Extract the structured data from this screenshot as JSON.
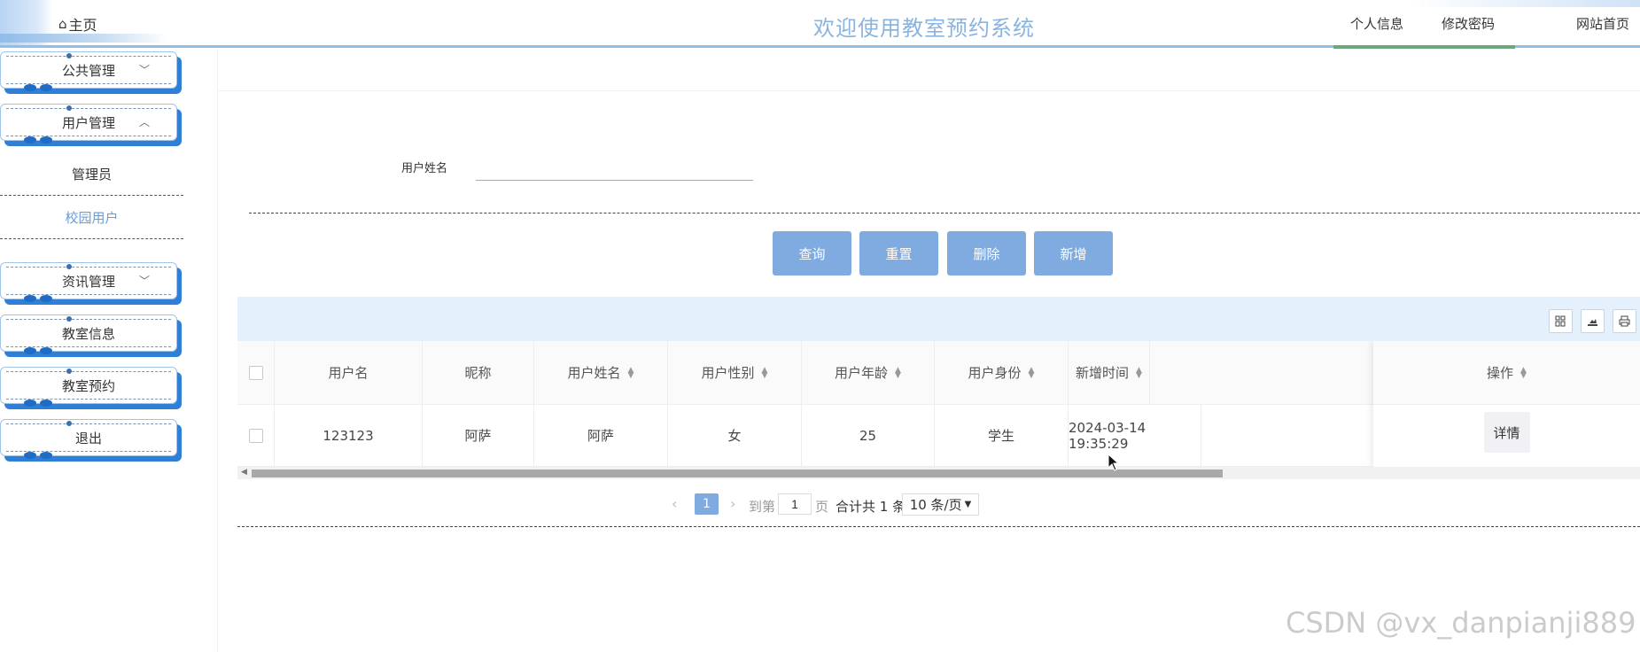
{
  "header": {
    "home_label": "主页",
    "home_icon": "home-icon",
    "title": "欢迎使用教室预约系统",
    "nav": {
      "profile": "个人信息",
      "change_password": "修改密码",
      "website_home": "网站首页"
    }
  },
  "sidebar": {
    "menus": [
      {
        "label": "公共管理",
        "chevron": "chevron-down-icon"
      },
      {
        "label": "用户管理",
        "chevron": "chevron-up-icon"
      },
      {
        "label": "资讯管理",
        "chevron": "chevron-down-icon"
      },
      {
        "label": "教室信息"
      },
      {
        "label": "教室预约"
      },
      {
        "label": "退出"
      }
    ],
    "submenu": [
      {
        "label": "管理员"
      },
      {
        "label": "校园用户",
        "active": true
      }
    ],
    "active_color": "#6a9bd6"
  },
  "search": {
    "label": "用户姓名",
    "value": ""
  },
  "actions": {
    "query": "查询",
    "reset": "重置",
    "delete": "删除",
    "add": "新增",
    "button_color": "#7fabe1"
  },
  "toolbar": {
    "icons": [
      "columns-icon",
      "export-icon",
      "print-icon"
    ],
    "background": "#e5f0fd"
  },
  "table": {
    "columns": [
      {
        "label": "用户名",
        "sortable": false
      },
      {
        "label": "昵称",
        "sortable": false
      },
      {
        "label": "用户姓名",
        "sortable": true
      },
      {
        "label": "用户性别",
        "sortable": true
      },
      {
        "label": "用户年龄",
        "sortable": true
      },
      {
        "label": "用户身份",
        "sortable": true
      },
      {
        "label": "新增时间",
        "sortable": true
      },
      {
        "label": "操作",
        "sortable": true
      }
    ],
    "rows": [
      {
        "username": "123123",
        "nickname": "阿萨",
        "real_name": "阿萨",
        "gender": "女",
        "age": "25",
        "identity": "学生",
        "created_at": "2024-03-14 19:35:29",
        "action": "详情"
      }
    ]
  },
  "pagination": {
    "current_page": "1",
    "goto_label": "到第",
    "goto_value": "1",
    "page_label": "页",
    "total_text": "合计共 1 条",
    "page_size": "10 条/页"
  },
  "watermark": "CSDN @vx_danpianji889"
}
